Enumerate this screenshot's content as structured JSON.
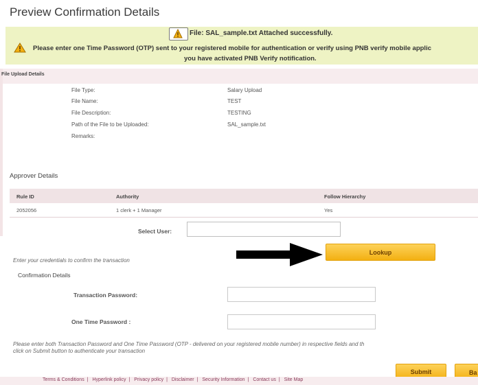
{
  "page": {
    "title": "Preview Confirmation Details"
  },
  "alerts": {
    "attached": "File: SAL_sample.txt Attached successfully.",
    "otp_line1": "Please enter one Time Password (OTP) sent to your registered mobile for authentication or verify using PNB verify mobile applic",
    "otp_line2": "you have activated PNB Verify notification."
  },
  "file_upload": {
    "section_label": "File Upload Details",
    "fields": [
      {
        "label": "File Type:",
        "value": "Salary Upload"
      },
      {
        "label": "File Name:",
        "value": "TEST"
      },
      {
        "label": "File Description:",
        "value": "TESTING"
      },
      {
        "label": "Path of the File to be Uploaded:",
        "value": "SAL_sample.txt"
      },
      {
        "label": "Remarks:",
        "value": ""
      }
    ]
  },
  "approver": {
    "title": "Approver Details",
    "columns": [
      "Rule ID",
      "Authority",
      "Follow Hierarchy"
    ],
    "rows": [
      {
        "rule_id": "2052056",
        "authority": "1 clerk + 1 Manager",
        "follow": "Yes"
      }
    ],
    "select_user_label": "Select User:",
    "select_user_value": "",
    "lookup_label": "Lookup"
  },
  "credentials": {
    "hint": "Enter your credentials to confirm the transaction",
    "title": "Confirmation Details",
    "transaction_password_label": "Transaction Password:",
    "otp_label": "One Time Password :",
    "note_line1": "Please enter both Transaction Password and One Time Password (OTP - delivered on your registered mobile number) in respective fields and th",
    "note_line2": "click on Submit button to authenticate your transaction"
  },
  "actions": {
    "submit": "Submit",
    "back": "Ba"
  },
  "footer": {
    "links": [
      "Terms & Conditions",
      "Hyperlink policy",
      "Privacy policy",
      "Disclaimer",
      "Security Information",
      "Contact us",
      "Site Map"
    ],
    "separator": "|"
  },
  "colors": {
    "accent": "#f3b012",
    "alert_bg": "#eef3c4",
    "section_bg": "#f7ecee"
  }
}
